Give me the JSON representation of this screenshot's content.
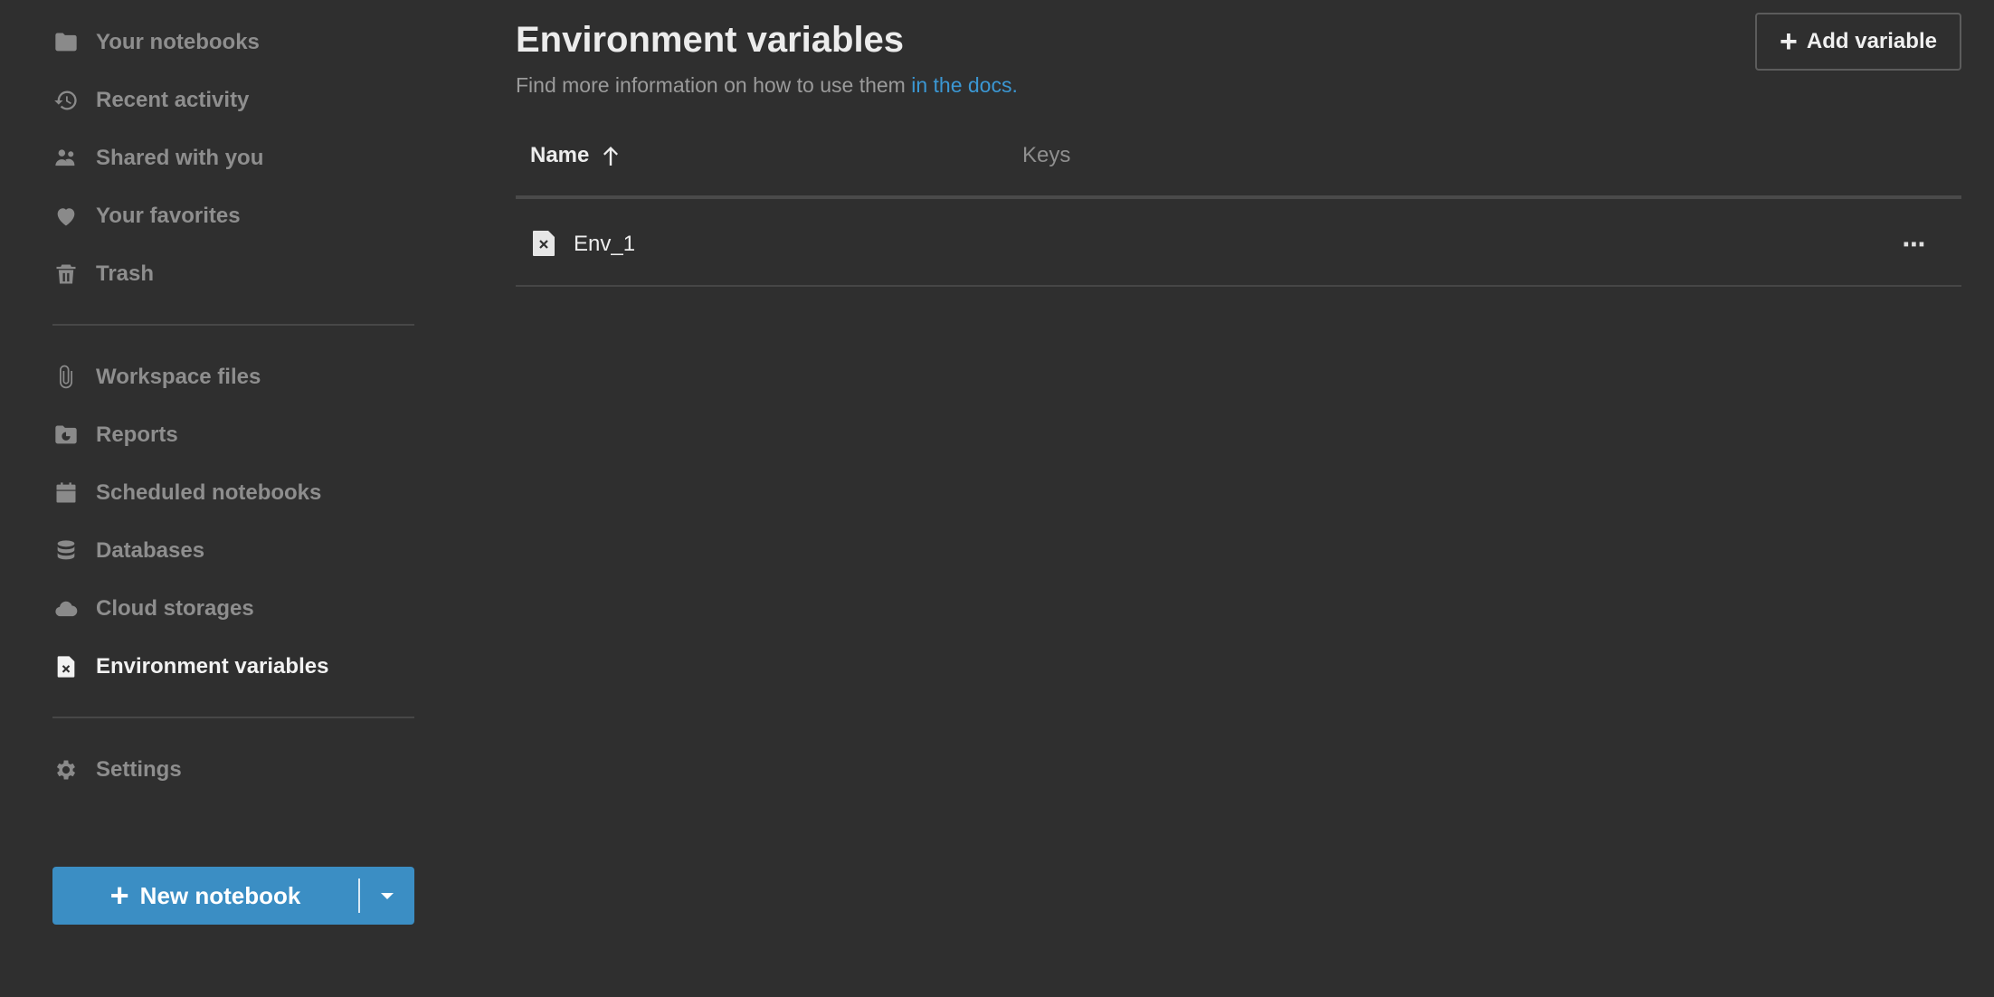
{
  "sidebar": {
    "items": [
      {
        "label": "Your notebooks",
        "icon": "folder-icon"
      },
      {
        "label": "Recent activity",
        "icon": "history-icon"
      },
      {
        "label": "Shared with you",
        "icon": "users-icon"
      },
      {
        "label": "Your favorites",
        "icon": "heart-icon"
      },
      {
        "label": "Trash",
        "icon": "trash-icon"
      },
      {
        "label": "Workspace files",
        "icon": "paperclip-icon"
      },
      {
        "label": "Reports",
        "icon": "report-folder-icon"
      },
      {
        "label": "Scheduled notebooks",
        "icon": "calendar-icon"
      },
      {
        "label": "Databases",
        "icon": "database-icon"
      },
      {
        "label": "Cloud storages",
        "icon": "cloud-icon"
      },
      {
        "label": "Environment variables",
        "icon": "env-variable-icon",
        "active": true
      },
      {
        "label": "Settings",
        "icon": "gear-icon"
      }
    ],
    "new_button": {
      "label": "New notebook",
      "color": "#3b8ec4"
    }
  },
  "main": {
    "title": "Environment variables",
    "subtitle": "Find more information on how to use them",
    "docs_link": "in the docs.",
    "add_button": "Add variable",
    "table": {
      "columns": [
        "Name",
        "Keys"
      ],
      "sort": {
        "column": "Name",
        "direction": "ascending"
      },
      "rows": [
        {
          "name": "Env_1",
          "keys": "",
          "icon": "env-variable-icon"
        }
      ]
    }
  },
  "colors": {
    "accent": "#3b8ec4",
    "link": "#3b97d3",
    "background": "#2f2f2f"
  }
}
